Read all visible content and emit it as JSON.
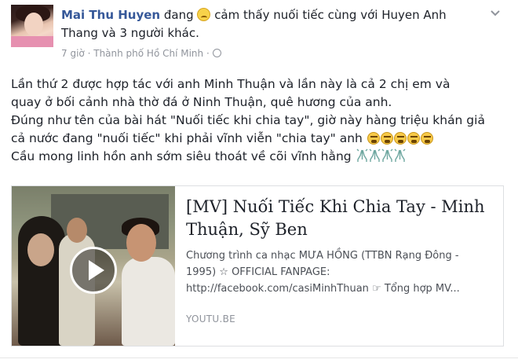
{
  "post": {
    "author": "Mai Thu Huyen",
    "feeling_prefix": "đang",
    "feeling_text": "cảm thấy nuối tiếc cùng với Huyen Anh Thang và 3 người khác.",
    "time": "7 giờ",
    "separator": "·",
    "location": "Thành phố Hồ Chí Minh",
    "privacy_dot": "·",
    "body_lines": [
      "Lần thứ 2 được hợp tác với anh Minh Thuận và lần này là cả 2 chị em và",
      "quay ở bối cảnh nhà thờ đá ở Ninh Thuận, quê hương của anh.",
      "Đúng như tên của bài hát \"Nuối tiếc khi chia tay\", giờ này hàng triệu khán giả",
      "cả nước đang \"nuối tiếc\" khi phải vĩnh viễn \"chia tay\" anh",
      "Cầu mong linh hồn anh sớm siêu thoát về cõi vĩnh hằng"
    ],
    "emoji_crying_count": 5,
    "emoji_pray_count": 4
  },
  "link_card": {
    "title": "[MV] Nuối Tiếc Khi Chia Tay - Minh Thuận, Sỹ Ben",
    "description_lines": [
      "Chương trình ca nhạc MƯA HỒNG (TTBN Rạng Đông -",
      "1995) ☆ OFFICIAL FANPAGE:",
      "http://facebook.com/casiMinhThuan ☞ Tổng hợp MV..."
    ],
    "source": "YOUTU.BE"
  },
  "icons": {
    "avatar": "profile-photo",
    "feeling": "sad-face-icon",
    "privacy": "globe-icon",
    "menu": "chevron-down-icon",
    "play": "play-icon",
    "crying": "crying-face-icon",
    "pray": "pray-hands-icon"
  },
  "colors": {
    "name_link": "#365899",
    "meta_gray": "#90949c",
    "text": "#1d2129"
  }
}
